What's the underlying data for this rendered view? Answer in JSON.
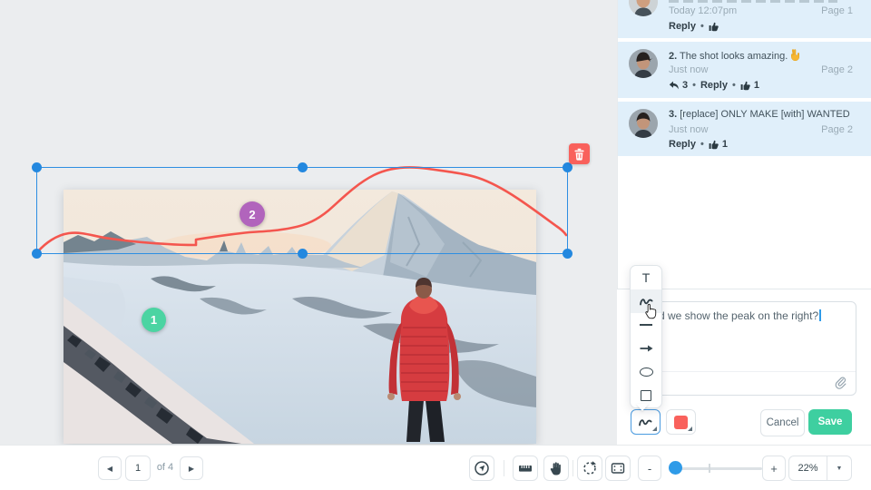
{
  "canvas": {
    "markers": [
      {
        "label": "1"
      },
      {
        "label": "2"
      }
    ],
    "annotation_color": "#f4564e",
    "selection_color": "#2d8ee2"
  },
  "sidebar": {
    "comments": [
      {
        "time": "Today 12:07pm",
        "page": "Page 1",
        "reply_label": "Reply"
      },
      {
        "number": "2.",
        "text": "The shot looks amazing.",
        "emoji_icon": "sign-of-the-horns-emoji",
        "time": "Just now",
        "page": "Page 2",
        "reply_count": "3",
        "reply_label": "Reply",
        "like_count": "1"
      },
      {
        "number": "3.",
        "text": "[replace] ONLY MAKE [with] WANTED",
        "time": "Just now",
        "page": "Page 2",
        "reply_label": "Reply",
        "like_count": "1"
      }
    ],
    "compose": {
      "text": "d we show the peak on the right?",
      "cancel_label": "Cancel",
      "save_label": "Save"
    },
    "tools": {
      "text_tool_label": "T"
    }
  },
  "bottom_toolbar": {
    "page_current": "1",
    "page_of_label": "of 4",
    "prev_icon": "◀",
    "next_icon": "▶",
    "zoom_minus_label": "-",
    "zoom_plus_label": "+",
    "zoom_value": "22%",
    "dropdown_icon": "▼"
  },
  "strings": {
    "bullet": "•"
  },
  "colors": {
    "accent_blue": "#2f9be8",
    "annotation_red": "#f4564e",
    "marker_green": "#4bd4a2",
    "marker_purple": "#b164bc",
    "save_green": "#3ecfa0",
    "comment_bg": "#e0effa",
    "canvas_bg": "#ebedef"
  }
}
